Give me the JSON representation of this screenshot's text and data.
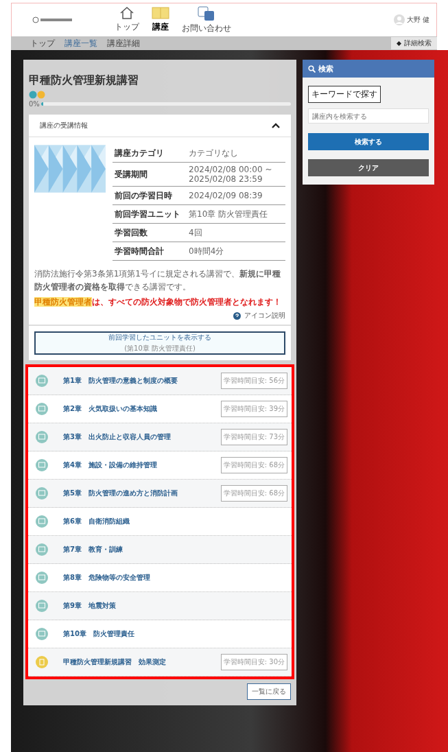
{
  "header": {
    "nav": [
      {
        "label": "トップ",
        "selected": false
      },
      {
        "label": "講座",
        "selected": true
      },
      {
        "label": "お問い合わせ",
        "selected": false
      }
    ],
    "user": "大野 健"
  },
  "breadcrumb": [
    "トップ",
    "講座一覧",
    "講座詳細"
  ],
  "detail_button": "詳細検索",
  "course": {
    "title": "甲種防火管理新規講習",
    "progress_label": "0%",
    "level": 0,
    "info_title": "講座の受講情報",
    "expanded": true,
    "info": [
      {
        "label": "講座カテゴリ",
        "value": "カテゴリなし"
      },
      {
        "label": "受講期間",
        "value": "2024/02/08 00:00 ~ 2025/02/08 23:59"
      },
      {
        "label": "前回の学習日時",
        "value": "2024/02/09 08:39"
      },
      {
        "label": "前回学習ユニット",
        "value": "第10章 防火管理責任"
      },
      {
        "label": "学習回数",
        "value": "4回"
      },
      {
        "label": "学習時間合計",
        "value": "0時間4分"
      }
    ],
    "description": "消防法施行令第3条第1項第1号イに規定される講習で、**新規に甲種防火管理者の資格を取得**できる講習です。",
    "note_lead": "甲種防火管理者",
    "note_rest": "は、すべての防火対象物で防火管理者となれます！",
    "icon_help": "アイコン説明",
    "resume": {
      "label": "前回学習したユニットを表示する",
      "sub": "(第10章 防火管理責任)"
    },
    "chapters": [
      {
        "kind": "chapter",
        "title": "第1章　防火管理の意義と制度の概要",
        "time": "学習時間目安: 56分"
      },
      {
        "kind": "chapter",
        "title": "第2章　火気取扱いの基本知識",
        "time": "学習時間目安: 39分"
      },
      {
        "kind": "chapter",
        "title": "第3章　出火防止と収容人員の管理",
        "time": "学習時間目安: 73分"
      },
      {
        "kind": "chapter",
        "title": "第4章　施設・設備の維持管理",
        "time": "学習時間目安: 68分"
      },
      {
        "kind": "chapter",
        "title": "第5章　防火管理の進め方と消防計画",
        "time": "学習時間目安: 68分"
      },
      {
        "kind": "chapter",
        "title": "第6章　自衛消防組織"
      },
      {
        "kind": "chapter",
        "title": "第7章　教育・訓練"
      },
      {
        "kind": "chapter",
        "title": "第8章　危険物等の安全管理"
      },
      {
        "kind": "chapter",
        "title": "第9章　地震対策"
      },
      {
        "kind": "chapter",
        "title": "第10章　防火管理責任"
      },
      {
        "kind": "test",
        "title": "甲種防火管理新規講習　効果測定",
        "time": "学習時間目安: 30分"
      }
    ],
    "back": "一覧に戻る"
  },
  "search": {
    "title": "検索",
    "keyword_tab": "キーワードで探す",
    "placeholder": "講座内を検索する",
    "submit": "検索する",
    "clear": "クリア"
  }
}
